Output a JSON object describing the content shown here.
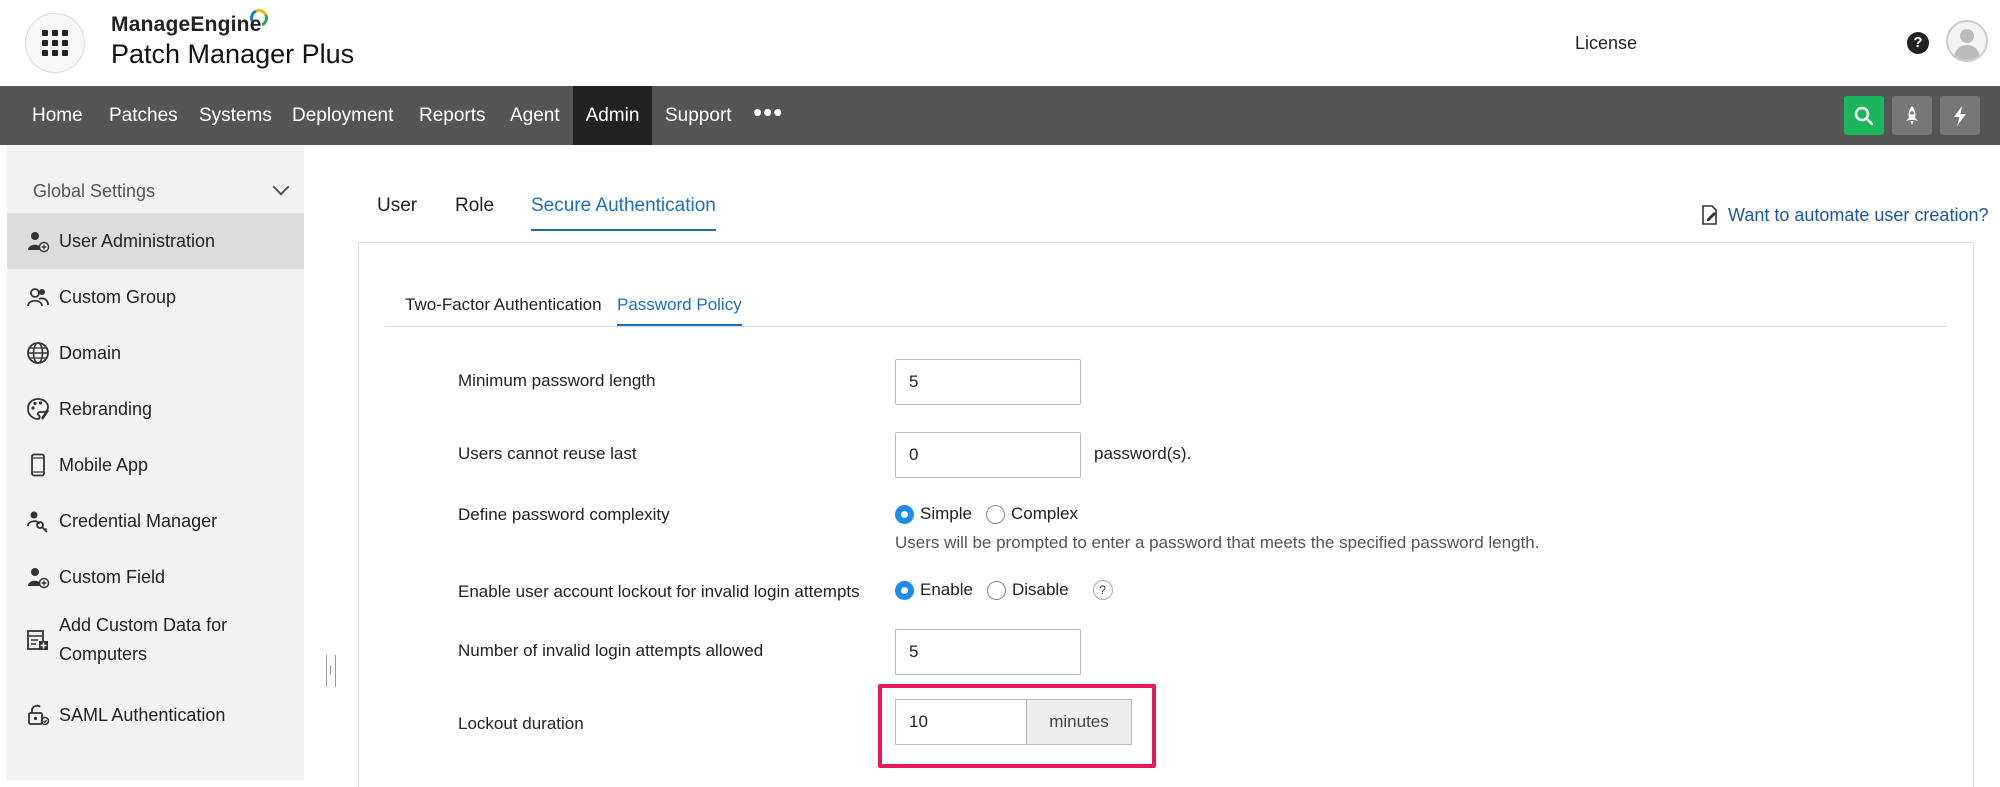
{
  "header": {
    "brand_company": "ManageEngine",
    "brand_product": "Patch Manager Plus",
    "license_label": "License",
    "help_glyph": "?"
  },
  "nav": {
    "items": [
      "Home",
      "Patches",
      "Systems",
      "Deployment",
      "Reports",
      "Agent",
      "Admin",
      "Support"
    ],
    "active": "Admin",
    "more_glyph": "•••"
  },
  "sidebar": {
    "heading": "Global Settings",
    "items": [
      {
        "label": "User Administration",
        "icon": "user-admin-icon"
      },
      {
        "label": "Custom Group",
        "icon": "custom-group-icon"
      },
      {
        "label": "Domain",
        "icon": "globe-icon"
      },
      {
        "label": "Rebranding",
        "icon": "palette-icon"
      },
      {
        "label": "Mobile App",
        "icon": "mobile-icon"
      },
      {
        "label": "Credential Manager",
        "icon": "key-user-icon"
      },
      {
        "label": "Custom Field",
        "icon": "user-plus-icon"
      },
      {
        "label": "Add Custom Data for Computers",
        "icon": "custom-data-icon"
      },
      {
        "label": "SAML Authentication",
        "icon": "lock-icon"
      }
    ],
    "active_index": 0
  },
  "tabs": {
    "items": [
      "User",
      "Role",
      "Secure Authentication"
    ],
    "active": "Secure Authentication",
    "automate_link": "Want to automate user creation?"
  },
  "subtabs": {
    "items": [
      "Two-Factor Authentication",
      "Password Policy"
    ],
    "active": "Password Policy"
  },
  "form": {
    "min_length_label": "Minimum password length",
    "min_length_value": "5",
    "reuse_label": "Users cannot reuse last",
    "reuse_value": "0",
    "reuse_suffix": "password(s).",
    "complexity_label": "Define password complexity",
    "complexity_options": [
      "Simple",
      "Complex"
    ],
    "complexity_selected": "Simple",
    "complexity_hint": "Users will be prompted to enter a password that meets the specified password length.",
    "lockout_label": "Enable user account lockout for invalid login attempts",
    "lockout_options": [
      "Enable",
      "Disable"
    ],
    "lockout_selected": "Enable",
    "lockout_help": "?",
    "attempts_label": "Number of invalid login attempts allowed",
    "attempts_value": "5",
    "duration_label": "Lockout duration",
    "duration_value": "10",
    "duration_unit": "minutes"
  },
  "colors": {
    "accent": "#1a6fc4",
    "highlight": "#e8195a",
    "search_button": "#1ab55c",
    "nav_bg": "#555555"
  }
}
